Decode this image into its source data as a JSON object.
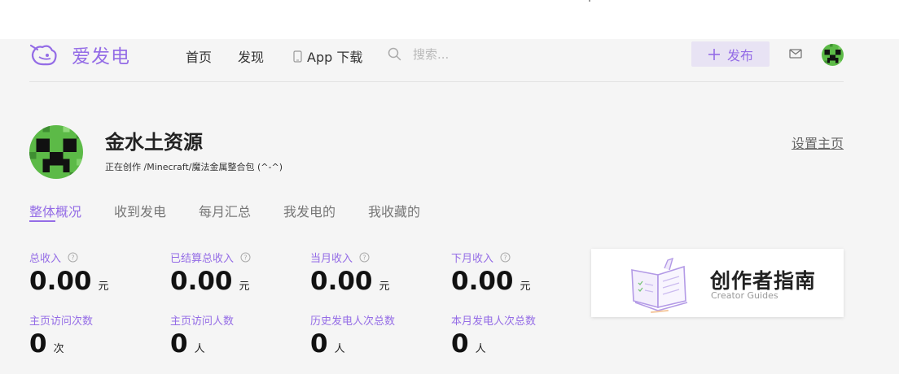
{
  "brand": {
    "name": "爱发电",
    "accent": "#946ce6"
  },
  "nav": {
    "home": "首页",
    "discover": "发现",
    "app_download": "App 下载",
    "search_placeholder": "搜索...",
    "publish_label": "发布",
    "publish_icon": "plus-icon",
    "mail_icon": "mail-icon"
  },
  "profile": {
    "name": "金水土资源",
    "subtitle": "正在创作 /Minecraft/魔法金属整合包 (^-^)",
    "settings_link": "设置主页"
  },
  "tabs": [
    {
      "label": "整体概况",
      "active": true
    },
    {
      "label": "收到发电",
      "active": false
    },
    {
      "label": "每月汇总",
      "active": false
    },
    {
      "label": "我发电的",
      "active": false
    },
    {
      "label": "我收藏的",
      "active": false
    }
  ],
  "stats": [
    {
      "label": "总收入",
      "value": "0.00",
      "unit": "元",
      "help": true
    },
    {
      "label": "已结算总收入",
      "value": "0.00",
      "unit": "元",
      "help": true
    },
    {
      "label": "当月收入",
      "value": "0.00",
      "unit": "元",
      "help": true
    },
    {
      "label": "下月收入",
      "value": "0.00",
      "unit": "元",
      "help": true
    },
    {
      "label": "主页访问次数",
      "value": "0",
      "unit": "次",
      "help": false
    },
    {
      "label": "主页访问人数",
      "value": "0",
      "unit": "人",
      "help": false
    },
    {
      "label": "历史发电人次总数",
      "value": "0",
      "unit": "人",
      "help": false
    },
    {
      "label": "本月发电人次总数",
      "value": "0",
      "unit": "人",
      "help": false
    }
  ],
  "guide": {
    "title": "创作者指南",
    "subtitle": "Creator Guides"
  }
}
